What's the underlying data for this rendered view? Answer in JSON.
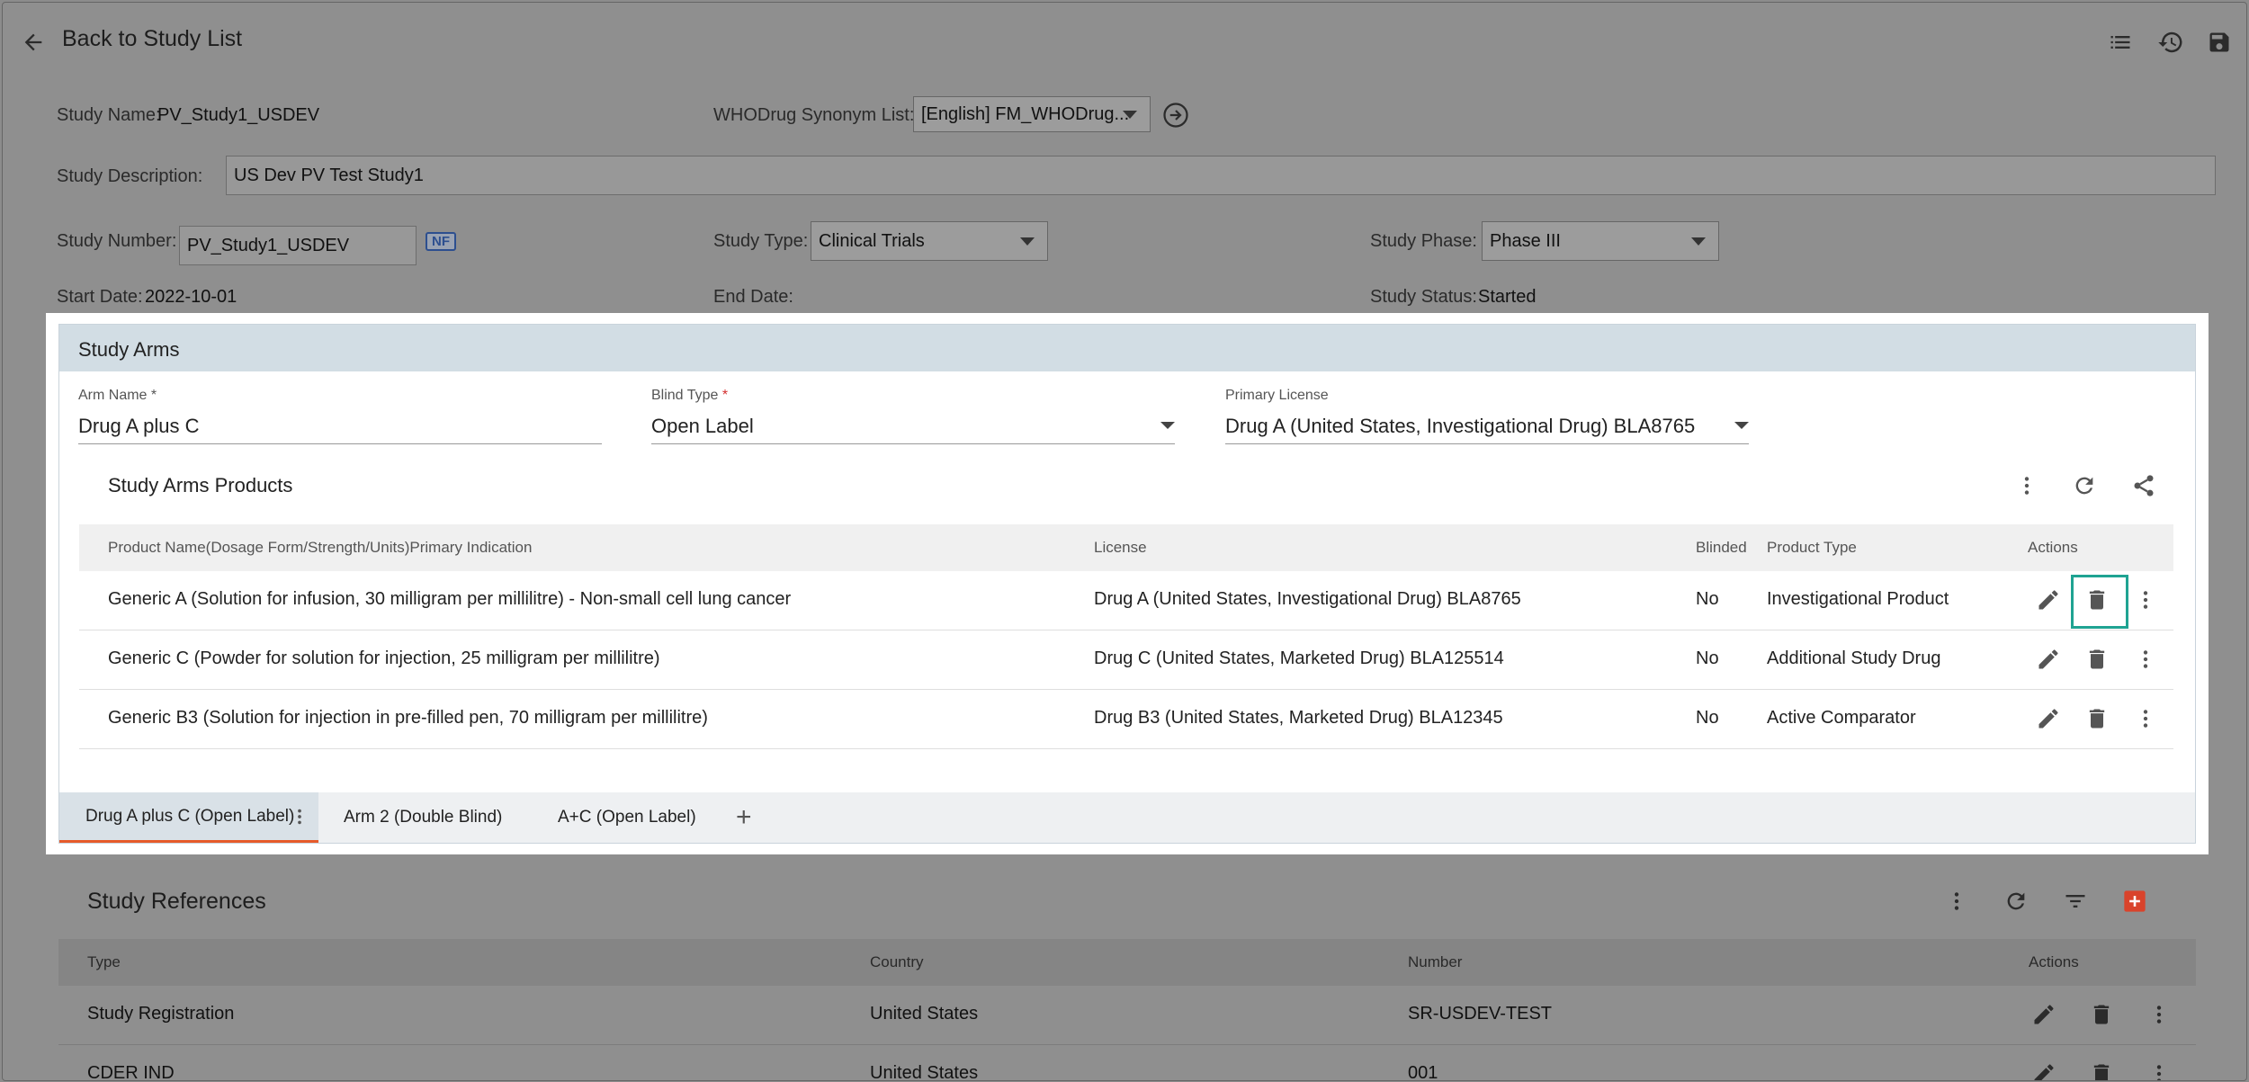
{
  "header": {
    "back_label": "Back to Study List",
    "icons": [
      "back-arrow-icon",
      "list-icon",
      "history-icon",
      "save-icon"
    ]
  },
  "study": {
    "name_label": "Study Name:",
    "name_value": "PV_Study1_USDEV",
    "whodrug_label": "WHODrug Synonym List:",
    "whodrug_value": "[English] FM_WHODrug...",
    "description_label": "Study Description:",
    "description_value": "US Dev PV Test Study1",
    "number_label": "Study Number:",
    "number_value": "PV_Study1_USDEV",
    "nf_badge": "NF",
    "type_label": "Study Type:",
    "type_value": "Clinical Trials",
    "phase_label": "Study Phase:",
    "phase_value": "Phase III",
    "start_label": "Start Date:",
    "start_value": "2022-10-01",
    "end_label": "End Date:",
    "end_value": "",
    "status_label": "Study Status:",
    "status_value": "Started"
  },
  "study_arms": {
    "title": "Study Arms",
    "arm_name_label": "Arm Name *",
    "arm_name_value": "Drug A plus C",
    "blind_type_label": "Blind Type",
    "blind_type_req": "*",
    "blind_type_value": "Open Label",
    "primary_license_label": "Primary License",
    "primary_license_value": "Drug A (United States, Investigational Drug) BLA8765",
    "products_title": "Study Arms Products",
    "columns": {
      "product": "Product Name(Dosage Form/Strength/Units)Primary Indication",
      "license": "License",
      "blinded": "Blinded",
      "product_type": "Product Type",
      "actions": "Actions"
    },
    "rows": [
      {
        "product": "Generic A (Solution for infusion, 30 milligram per millilitre) - Non-small cell lung cancer",
        "license": "Drug A (United States, Investigational Drug) BLA8765",
        "blinded": "No",
        "product_type": "Investigational Product"
      },
      {
        "product": "Generic C (Powder for solution for injection, 25 milligram per millilitre)",
        "license": "Drug C (United States, Marketed Drug) BLA125514",
        "blinded": "No",
        "product_type": "Additional Study Drug"
      },
      {
        "product": "Generic B3 (Solution for injection in pre-filled pen, 70 milligram per millilitre)",
        "license": "Drug B3 (United States, Marketed Drug) BLA12345",
        "blinded": "No",
        "product_type": "Active Comparator"
      }
    ],
    "tabs": [
      {
        "label": "Drug A plus C (Open Label)",
        "active": true
      },
      {
        "label": "Arm 2 (Double Blind)",
        "active": false
      },
      {
        "label": "A+C (Open Label)",
        "active": false
      }
    ],
    "add_tab_symbol": "+"
  },
  "study_references": {
    "title": "Study References",
    "columns": {
      "type": "Type",
      "country": "Country",
      "number": "Number",
      "actions": "Actions"
    },
    "rows": [
      {
        "type": "Study Registration",
        "country": "United States",
        "number": "SR-USDEV-TEST"
      },
      {
        "type": "CDER IND",
        "country": "United States",
        "number": "001"
      }
    ]
  },
  "colors": {
    "overlay_gray": "#8f8f8f",
    "panel_header": "#d2dde4",
    "highlight_border": "#1fa392",
    "active_tab_underline": "#e65a2a",
    "add_button": "#d9432b"
  }
}
